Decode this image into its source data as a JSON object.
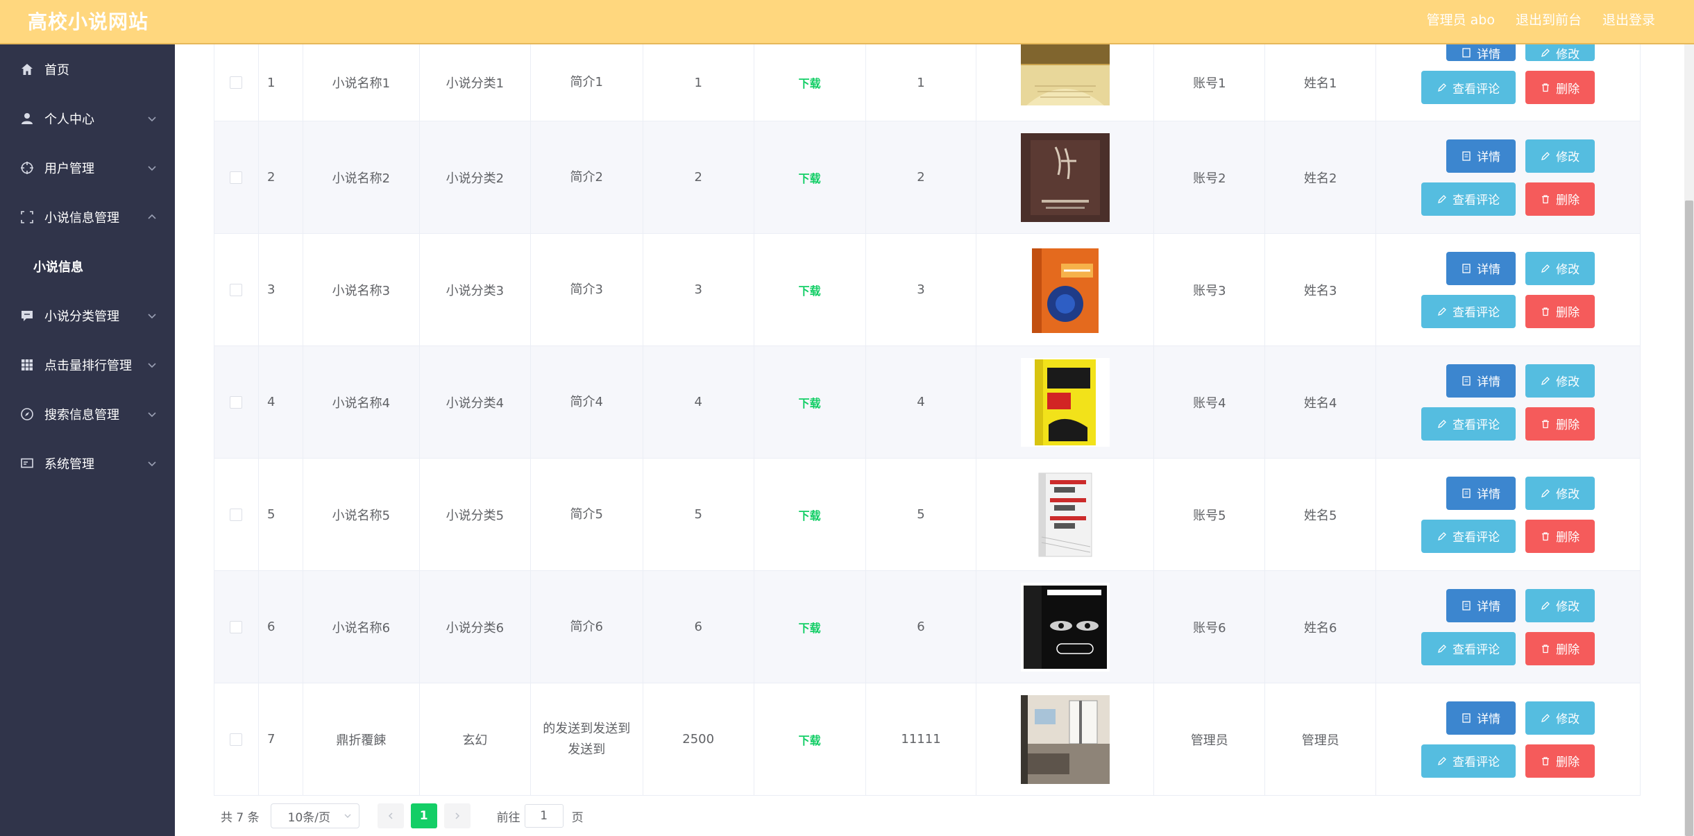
{
  "app": {
    "title": "高校小说网站"
  },
  "header": {
    "user": "管理员 abo",
    "front": "退出到前台",
    "logout": "退出登录"
  },
  "sidebar": {
    "items": [
      {
        "label": "首页",
        "icon": "home-icon",
        "expandable": false
      },
      {
        "label": "个人中心",
        "icon": "user-icon",
        "expandable": true
      },
      {
        "label": "用户管理",
        "icon": "crosshair-icon",
        "expandable": true
      },
      {
        "label": "小说信息管理",
        "icon": "frame-icon",
        "expandable": true,
        "expanded": true
      },
      {
        "label": "小说信息",
        "sub": true
      },
      {
        "label": "小说分类管理",
        "icon": "chat-icon",
        "expandable": true
      },
      {
        "label": "点击量排行管理",
        "icon": "grid-icon",
        "expandable": true
      },
      {
        "label": "搜索信息管理",
        "icon": "compass-icon",
        "expandable": true
      },
      {
        "label": "系统管理",
        "icon": "monitor-icon",
        "expandable": true
      }
    ]
  },
  "table": {
    "download_label": "下载",
    "buttons": {
      "detail": "详情",
      "edit": "修改",
      "review": "查看评论",
      "delete": "删除"
    },
    "rows": [
      {
        "idx": "1",
        "name": "小说名称1",
        "category": "小说分类1",
        "intro": "简介1",
        "clicks": "1",
        "searches": "1",
        "account": "账号1",
        "username": "姓名1",
        "cover": "open-book"
      },
      {
        "idx": "2",
        "name": "小说名称2",
        "category": "小说分类2",
        "intro": "简介2",
        "clicks": "2",
        "searches": "2",
        "account": "账号2",
        "username": "姓名2",
        "cover": "dark-calligraphy-book"
      },
      {
        "idx": "3",
        "name": "小说名称3",
        "category": "小说分类3",
        "intro": "简介3",
        "clicks": "3",
        "searches": "3",
        "account": "账号3",
        "username": "姓名3",
        "cover": "orange-memory-book"
      },
      {
        "idx": "4",
        "name": "小说名称4",
        "category": "小说分类4",
        "intro": "简介4",
        "clicks": "4",
        "searches": "4",
        "account": "账号4",
        "username": "姓名4",
        "cover": "yellow-sales-book"
      },
      {
        "idx": "5",
        "name": "小说名称5",
        "category": "小说分类5",
        "intro": "简介5",
        "clicks": "5",
        "searches": "5",
        "account": "账号5",
        "username": "姓名5",
        "cover": "white-red-book"
      },
      {
        "idx": "6",
        "name": "小说名称6",
        "category": "小说分类6",
        "intro": "简介6",
        "clicks": "6",
        "searches": "6",
        "account": "账号6",
        "username": "姓名6",
        "cover": "black-psychology-book"
      },
      {
        "idx": "7",
        "name": "鼎折覆餗",
        "category": "玄幻",
        "intro": "的发送到发送到发送到",
        "clicks": "2500",
        "searches": "11111",
        "account": "管理员",
        "username": "管理员",
        "cover": "room-photo"
      }
    ]
  },
  "pager": {
    "total": "共 7 条",
    "page_size": "10条/页",
    "current": "1",
    "goto_label": "前往",
    "goto_value": "1",
    "unit": "页"
  }
}
